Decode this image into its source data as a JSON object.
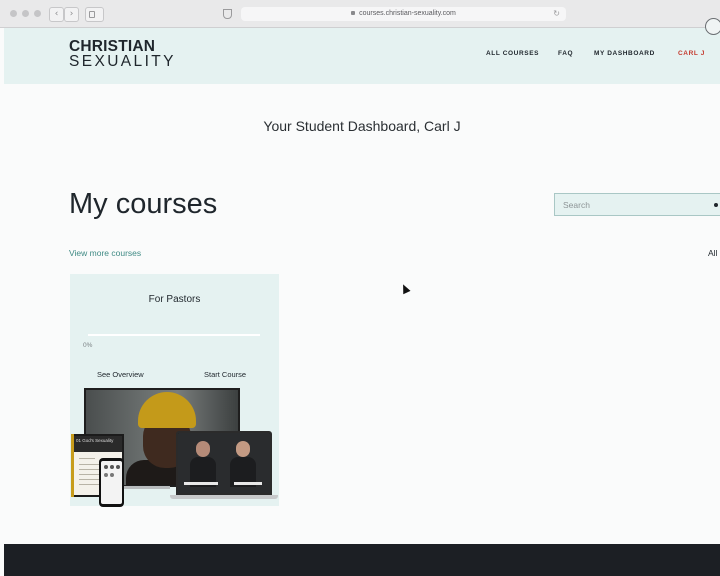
{
  "browser": {
    "url": "courses.christian-sexuality.com"
  },
  "header": {
    "logo_line1": "CHRISTIAN",
    "logo_line2": "SEXUALITY",
    "nav": {
      "all_courses": "ALL COURSES",
      "faq": "FAQ",
      "my_dashboard": "MY DASHBOARD",
      "user": "CARL J"
    }
  },
  "main": {
    "dashboard_title": "Your Student Dashboard, Carl J",
    "section_title": "My courses",
    "search_placeholder": "Search",
    "view_more": "View more courses",
    "filter_label": "All"
  },
  "course_card": {
    "title": "For Pastors",
    "progress_fraction": 0,
    "progress_label": "0%",
    "see_overview": "See Overview",
    "start_course": "Start Course",
    "image_text": {
      "book_heading": "01 God's Sexuality"
    }
  },
  "colors": {
    "header_bg": "#e5f2f1",
    "accent_teal": "#3f8a84",
    "user_red": "#c43a2e",
    "footer_bg": "#1c1f24"
  }
}
